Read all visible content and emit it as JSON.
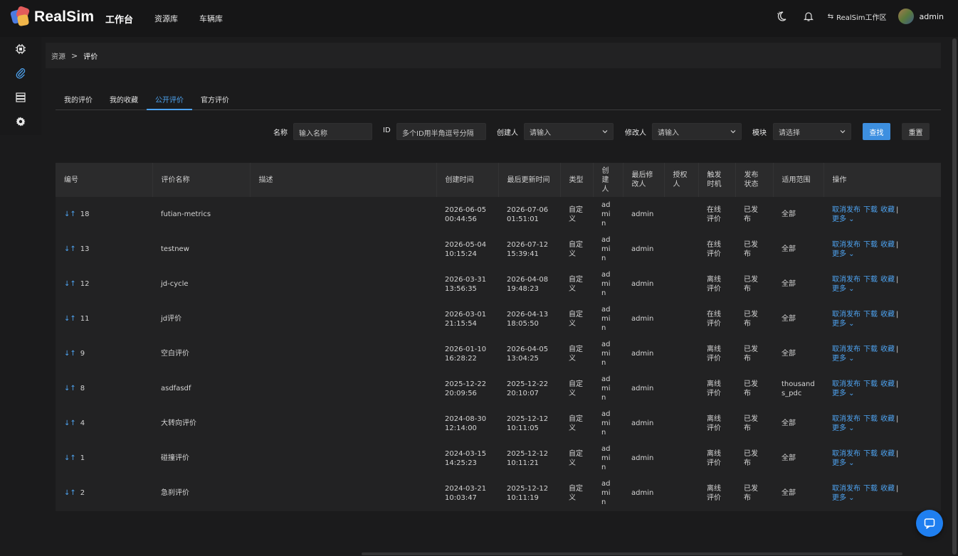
{
  "app": {
    "logo_text": "RealSim"
  },
  "topnav": {
    "items": [
      "工作台",
      "资源库",
      "车辆库"
    ]
  },
  "header": {
    "workspace_swap": "⇆",
    "workspace": "RealSim工作区",
    "username": "admin"
  },
  "breadcrumb": {
    "root": "资源",
    "sep": ">",
    "current": "评价"
  },
  "tabs": [
    {
      "label": "我的评价"
    },
    {
      "label": "我的收藏"
    },
    {
      "label": "公开评价"
    },
    {
      "label": "官方评价"
    }
  ],
  "filters": {
    "name_label": "名称",
    "name_placeholder": "输入名称",
    "id_label": "ID",
    "id_placeholder": "多个ID用半角逗号分隔",
    "creator_label": "创建人",
    "creator_placeholder": "请输入",
    "modifier_label": "修改人",
    "modifier_placeholder": "请输入",
    "module_label": "模块",
    "module_placeholder": "请选择",
    "search_btn": "查找",
    "reset_btn": "重置"
  },
  "table": {
    "columns": [
      "编号",
      "评价名称",
      "描述",
      "创建时间",
      "最后更新时间",
      "类型",
      "创建人",
      "最后修改人",
      "授权人",
      "触发时机",
      "发布状态",
      "适用范围",
      "操作"
    ],
    "sort_icon": "↓↑",
    "op_labels": {
      "unpublish": "取消发布",
      "download": "下载",
      "favorite": "收藏",
      "bar": "|",
      "more": "更多 ⌄"
    },
    "rows": [
      {
        "id": "18",
        "name": "futian-metrics",
        "desc": "",
        "created": "2026-06-05 00:44:56",
        "updated": "2026-07-06 01:51:01",
        "type": "自定义",
        "creator": "admin",
        "modifier": "admin",
        "auth": "",
        "trigger": "在线评价",
        "status": "已发布",
        "scope": "全部"
      },
      {
        "id": "13",
        "name": "testnew",
        "desc": "",
        "created": "2026-05-04 10:15:24",
        "updated": "2026-07-12 15:39:41",
        "type": "自定义",
        "creator": "admin",
        "modifier": "admin",
        "auth": "",
        "trigger": "在线评价",
        "status": "已发布",
        "scope": "全部"
      },
      {
        "id": "12",
        "name": "jd-cycle",
        "desc": "",
        "created": "2026-03-31 13:56:35",
        "updated": "2026-04-08 19:48:23",
        "type": "自定义",
        "creator": "admin",
        "modifier": "admin",
        "auth": "",
        "trigger": "离线评价",
        "status": "已发布",
        "scope": "全部"
      },
      {
        "id": "11",
        "name": "jd评价",
        "desc": "",
        "created": "2026-03-01 21:15:54",
        "updated": "2026-04-13 18:05:50",
        "type": "自定义",
        "creator": "admin",
        "modifier": "admin",
        "auth": "",
        "trigger": "在线评价",
        "status": "已发布",
        "scope": "全部"
      },
      {
        "id": "9",
        "name": "空白评价",
        "desc": "",
        "created": "2026-01-10 16:28:22",
        "updated": "2026-04-05 13:04:25",
        "type": "自定义",
        "creator": "admin",
        "modifier": "admin",
        "auth": "",
        "trigger": "离线评价",
        "status": "已发布",
        "scope": "全部"
      },
      {
        "id": "8",
        "name": "asdfasdf",
        "desc": "",
        "created": "2025-12-22 20:09:56",
        "updated": "2025-12-22 20:10:07",
        "type": "自定义",
        "creator": "admin",
        "modifier": "admin",
        "auth": "",
        "trigger": "离线评价",
        "status": "已发布",
        "scope": "thousands_pdc"
      },
      {
        "id": "4",
        "name": "大转向评价",
        "desc": "",
        "created": "2024-08-30 12:14:00",
        "updated": "2025-12-12 10:11:05",
        "type": "自定义",
        "creator": "admin",
        "modifier": "admin",
        "auth": "",
        "trigger": "离线评价",
        "status": "已发布",
        "scope": "全部"
      },
      {
        "id": "1",
        "name": "碰撞评价",
        "desc": "",
        "created": "2024-03-15 14:25:23",
        "updated": "2025-12-12 10:11:21",
        "type": "自定义",
        "creator": "admin",
        "modifier": "admin",
        "auth": "",
        "trigger": "离线评价",
        "status": "已发布",
        "scope": "全部"
      },
      {
        "id": "2",
        "name": "急刹评价",
        "desc": "",
        "created": "2024-03-21 10:03:47",
        "updated": "2025-12-12 10:11:19",
        "type": "自定义",
        "creator": "admin",
        "modifier": "admin",
        "auth": "",
        "trigger": "离线评价",
        "status": "已发布",
        "scope": "全部"
      }
    ]
  },
  "colors": {
    "accent": "#4ea3f0",
    "primary_button": "#3d8fe0",
    "fab": "#1f7ff0"
  }
}
